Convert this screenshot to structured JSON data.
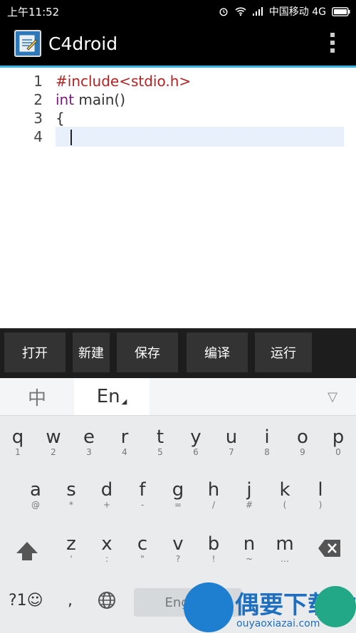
{
  "status": {
    "time": "上午11:52",
    "carrier": "中国移动 4G"
  },
  "app": {
    "title": "C4droid",
    "icon": "notepad-pen-icon"
  },
  "editor": {
    "lines": [
      {
        "num": "1",
        "text": "#include<stdio.h>"
      },
      {
        "num": "2",
        "kw": "int",
        "text": " main()"
      },
      {
        "num": "3",
        "text": "{"
      },
      {
        "num": "4",
        "text": ""
      }
    ]
  },
  "toolbar": {
    "open": "打开",
    "new": "新建",
    "save": "保存",
    "compile": "编译",
    "run": "运行"
  },
  "keyboard": {
    "lang_zh": "中",
    "lang_en": "En",
    "row1": [
      {
        "k": "q",
        "s": "1"
      },
      {
        "k": "w",
        "s": "2"
      },
      {
        "k": "e",
        "s": "3"
      },
      {
        "k": "r",
        "s": "4"
      },
      {
        "k": "t",
        "s": "5"
      },
      {
        "k": "y",
        "s": "6"
      },
      {
        "k": "u",
        "s": "7"
      },
      {
        "k": "i",
        "s": "8"
      },
      {
        "k": "o",
        "s": "9"
      },
      {
        "k": "p",
        "s": "0"
      }
    ],
    "row2": [
      {
        "k": "a",
        "s": "@"
      },
      {
        "k": "s",
        "s": "*"
      },
      {
        "k": "d",
        "s": "+"
      },
      {
        "k": "f",
        "s": "-"
      },
      {
        "k": "g",
        "s": "="
      },
      {
        "k": "h",
        "s": "/"
      },
      {
        "k": "j",
        "s": "#"
      },
      {
        "k": "k",
        "s": "("
      },
      {
        "k": "l",
        "s": ")"
      }
    ],
    "row3": [
      {
        "k": "z",
        "s": "'"
      },
      {
        "k": "x",
        "s": ":"
      },
      {
        "k": "c",
        "s": "\""
      },
      {
        "k": "v",
        "s": "?"
      },
      {
        "k": "b",
        "s": "!"
      },
      {
        "k": "n",
        "s": "~"
      },
      {
        "k": "m",
        "s": "…"
      }
    ],
    "symbols": "?1☺",
    "comma": ",",
    "space": "English"
  },
  "watermark": {
    "name": "偶要下载站",
    "url": "ouyaoxiazai.com"
  }
}
